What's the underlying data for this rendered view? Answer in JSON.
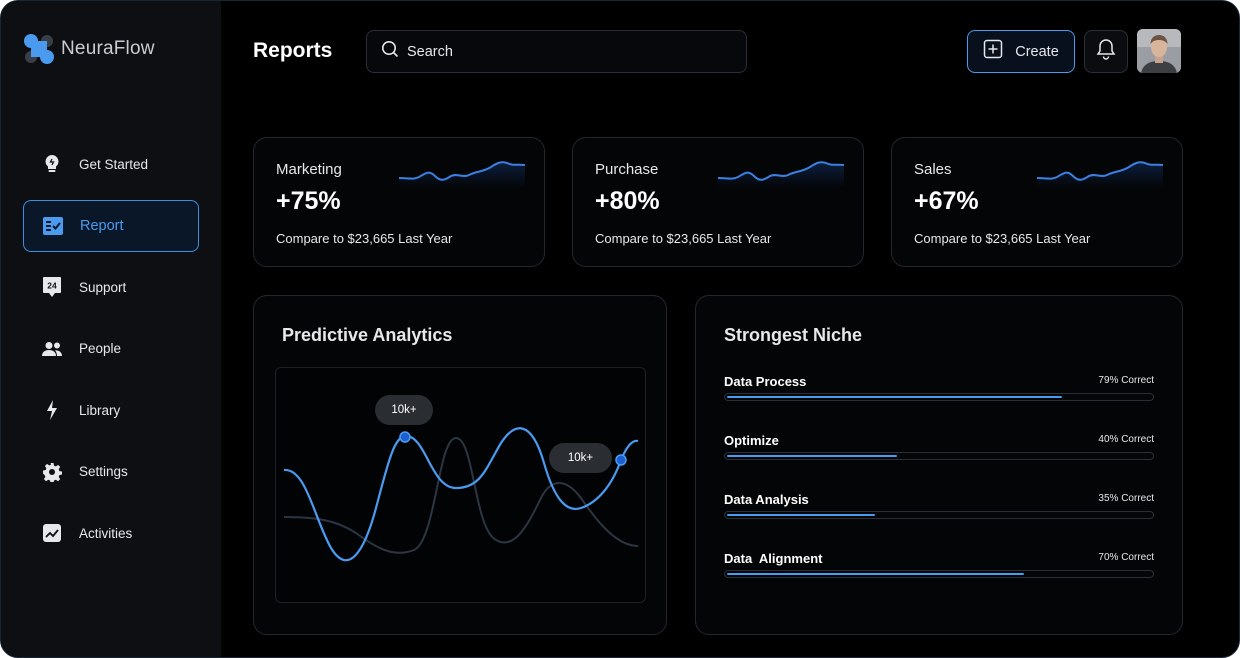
{
  "app": {
    "name": "NeuraFlow"
  },
  "sidebar": {
    "items": [
      {
        "label": "Get Started",
        "icon": "lightbulb-icon",
        "active": false
      },
      {
        "label": "Report",
        "icon": "report-icon",
        "active": true
      },
      {
        "label": "Support",
        "icon": "support-24-icon",
        "active": false
      },
      {
        "label": "People",
        "icon": "people-icon",
        "active": false
      },
      {
        "label": "Library",
        "icon": "lightning-icon",
        "active": false
      },
      {
        "label": "Settings",
        "icon": "gear-icon",
        "active": false
      },
      {
        "label": "Activities",
        "icon": "activity-chart-icon",
        "active": false
      }
    ]
  },
  "header": {
    "title": "Reports",
    "search_placeholder": "Search",
    "create_label": "Create"
  },
  "stats": [
    {
      "label": "Marketing",
      "value": "+75%",
      "compare": "Compare to $23,665 Last Year"
    },
    {
      "label": "Purchase",
      "value": "+80%",
      "compare": "Compare to $23,665 Last Year"
    },
    {
      "label": "Sales",
      "value": "+67%",
      "compare": "Compare to $23,665 Last Year"
    }
  ],
  "analytics": {
    "title": "Predictive Analytics",
    "bubbles": [
      "10k+",
      "10k+"
    ]
  },
  "niche": {
    "title": "Strongest Niche",
    "items": [
      {
        "name": "Data Process",
        "pct_label": "79% Correct",
        "fraction": 0.79
      },
      {
        "name": "Optimize",
        "pct_label": "40% Correct",
        "fraction": 0.4
      },
      {
        "name": "Data Analysis",
        "pct_label": "35% Correct",
        "fraction": 0.35
      },
      {
        "name": "Data  Alignment",
        "pct_label": "70% Correct",
        "fraction": 0.7
      }
    ]
  },
  "colors": {
    "accent": "#4a9bf0",
    "background": "#000000",
    "sidebar": "#0d0f13",
    "secondary_line": "#2c3544"
  }
}
